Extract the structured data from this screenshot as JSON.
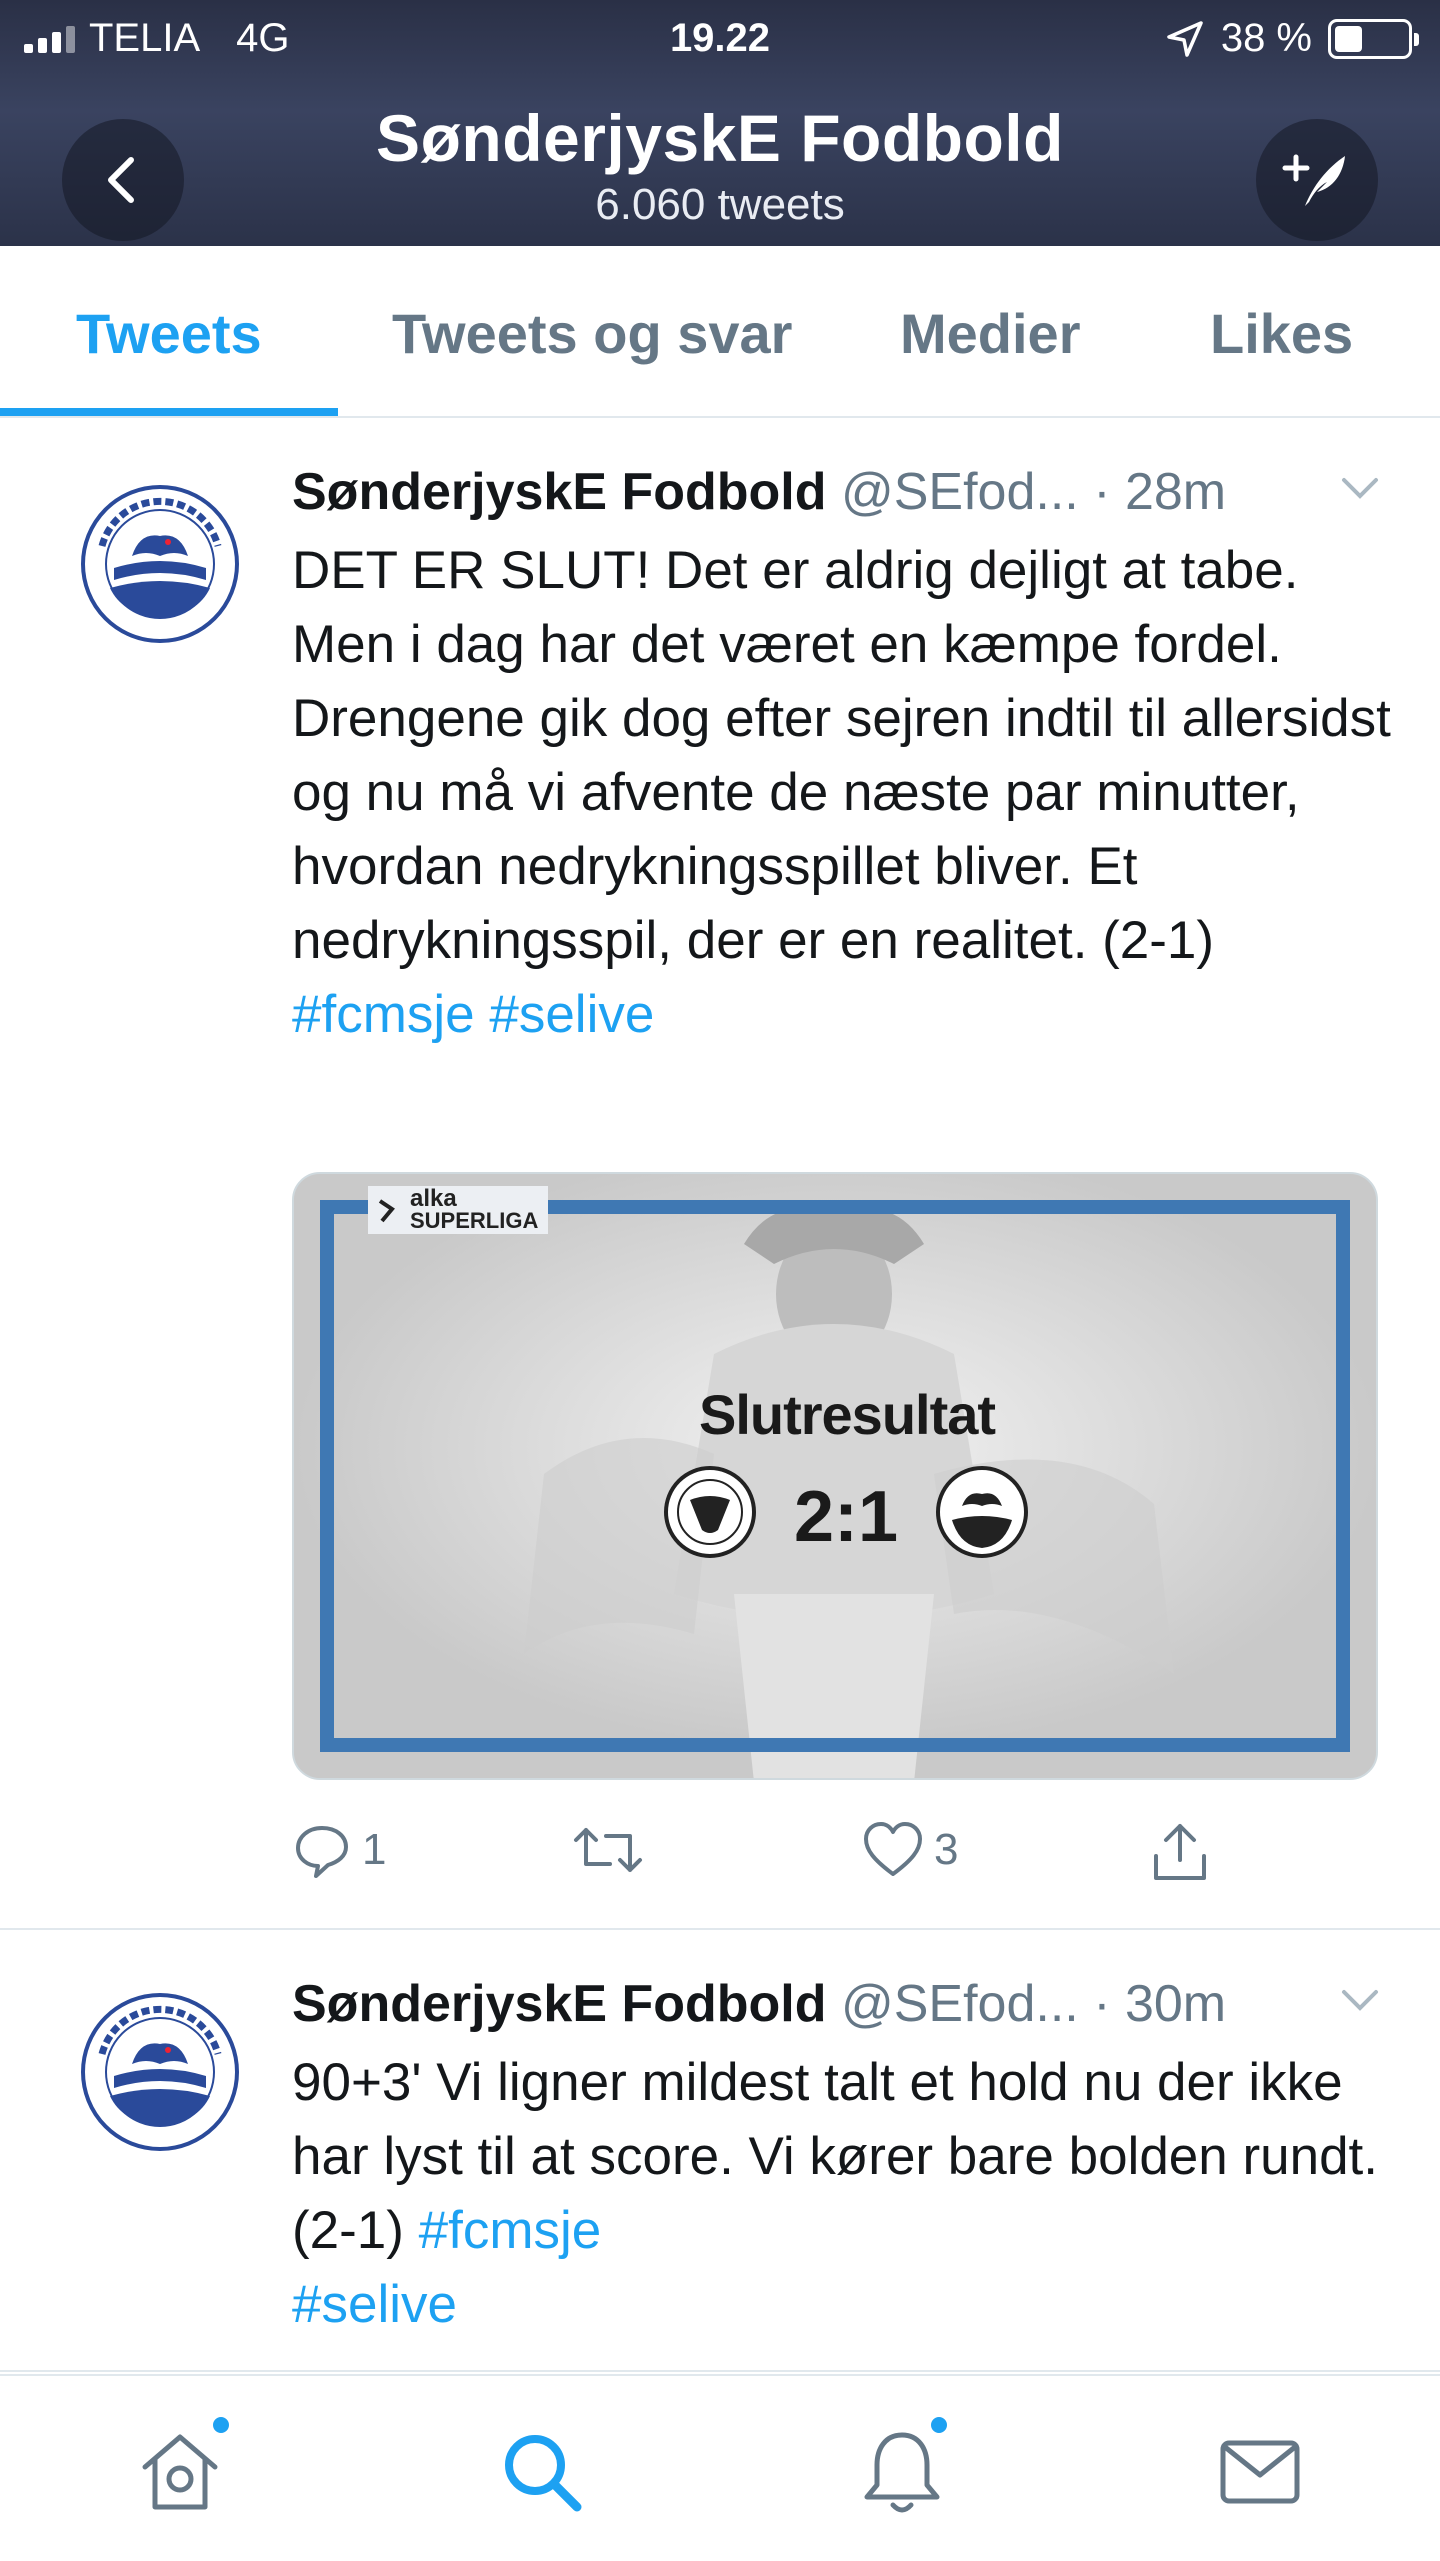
{
  "status_bar": {
    "carrier": "TELIA",
    "network": "4G",
    "time": "19.22",
    "battery_text": "38 %",
    "battery_level": 0.38
  },
  "header": {
    "title": "SønderjyskE Fodbold",
    "subtitle": "6.060 tweets",
    "back_icon": "chevron-left-icon",
    "compose_icon": "compose-tweet-icon"
  },
  "tabs": [
    {
      "label": "Tweets",
      "active": true
    },
    {
      "label": "Tweets og svar",
      "active": false
    },
    {
      "label": "Medier",
      "active": false
    },
    {
      "label": "Likes",
      "active": false
    }
  ],
  "tweets": [
    {
      "author": "SønderjyskE Fodbold",
      "handle": "@SEfod...",
      "time": "· 28m",
      "text": "DET ER SLUT! Det er aldrig dejligt at tabe. Men i dag har det været en kæmpe fordel. Drengene gik dog efter sejren indtil til allersidst og nu må vi afvente de næste par minutter, hvordan nedrykningsspillet bliver. Et nedrykningsspil, der er en realitet. (2-1)",
      "hashtags": [
        "#fcmsje",
        "#selive"
      ],
      "media": {
        "league_top": "alka",
        "league_bottom": "SUPERLIGA",
        "headline": "Slutresultat",
        "score": "2:1"
      },
      "actions": {
        "replies": "1",
        "retweets": "",
        "likes": "3"
      }
    },
    {
      "author": "SønderjyskE Fodbold",
      "handle": "@SEfod...",
      "time": "· 30m",
      "text": "90+3' Vi ligner mildest talt et hold nu der ikke har lyst til at score. Vi kører bare bolden rundt. (2-1) ",
      "hashtags": [
        "#fcmsje",
        "#selive"
      ]
    }
  ],
  "tabbar": {
    "items": [
      "home-icon",
      "search-icon",
      "notifications-icon",
      "messages-icon"
    ]
  },
  "colors": {
    "accent": "#1da1f2",
    "header_bg": "#323a54",
    "muted": "#657786",
    "media_frame": "#3f78b3"
  }
}
